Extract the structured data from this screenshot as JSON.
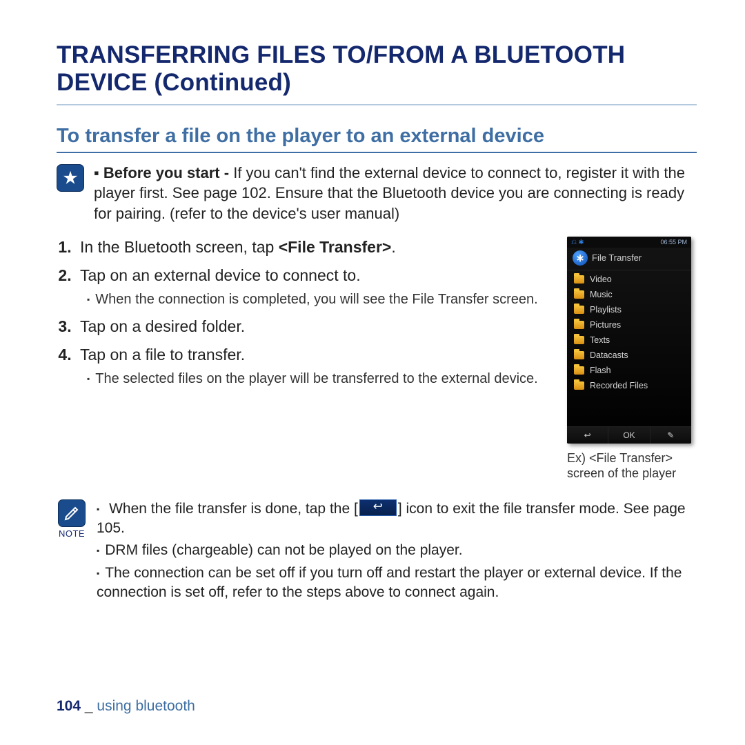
{
  "title": "TRANSFERRING FILES TO/FROM A BLUETOOTH DEVICE (Continued)",
  "section_heading": "To transfer a file on the player to an external device",
  "callout": {
    "label": "Before you start -",
    "text": "If you can't find the external device to connect to, register it with the player first. See page 102. Ensure that the Bluetooth device you are connecting is ready for pairing. (refer to the device's user manual)"
  },
  "steps": [
    {
      "pre": "In the Bluetooth screen, tap ",
      "bold": "<File Transfer>",
      "post": "."
    },
    {
      "text": "Tap on an external device to connect to.",
      "sub": [
        "When the connection is completed, you will see the File Transfer screen."
      ]
    },
    {
      "text": "Tap on a desired folder."
    },
    {
      "text": "Tap on a file to transfer.",
      "sub": [
        "The selected files on the player will be transferred to the external device."
      ]
    }
  ],
  "device": {
    "status_time": "06:55 PM",
    "header": "File Transfer",
    "folders": [
      "Video",
      "Music",
      "Playlists",
      "Pictures",
      "Texts",
      "Datacasts",
      "Flash",
      "Recorded Files"
    ],
    "footer": {
      "back": "↩",
      "ok": "OK",
      "write": "✎"
    },
    "caption": "Ex) <File Transfer> screen of the player"
  },
  "note": {
    "label": "NOTE",
    "items": [
      {
        "pre": "When the file transfer is done, tap the [",
        "post": "] icon to exit the file transfer mode. See page 105."
      },
      {
        "text": "DRM files (chargeable) can not be played on the player."
      },
      {
        "text": "The connection can be set off if you turn off and restart the player or external device. If the connection is set off, refer to the steps above to connect again."
      }
    ]
  },
  "footer": {
    "page": "104",
    "section": "using bluetooth"
  }
}
